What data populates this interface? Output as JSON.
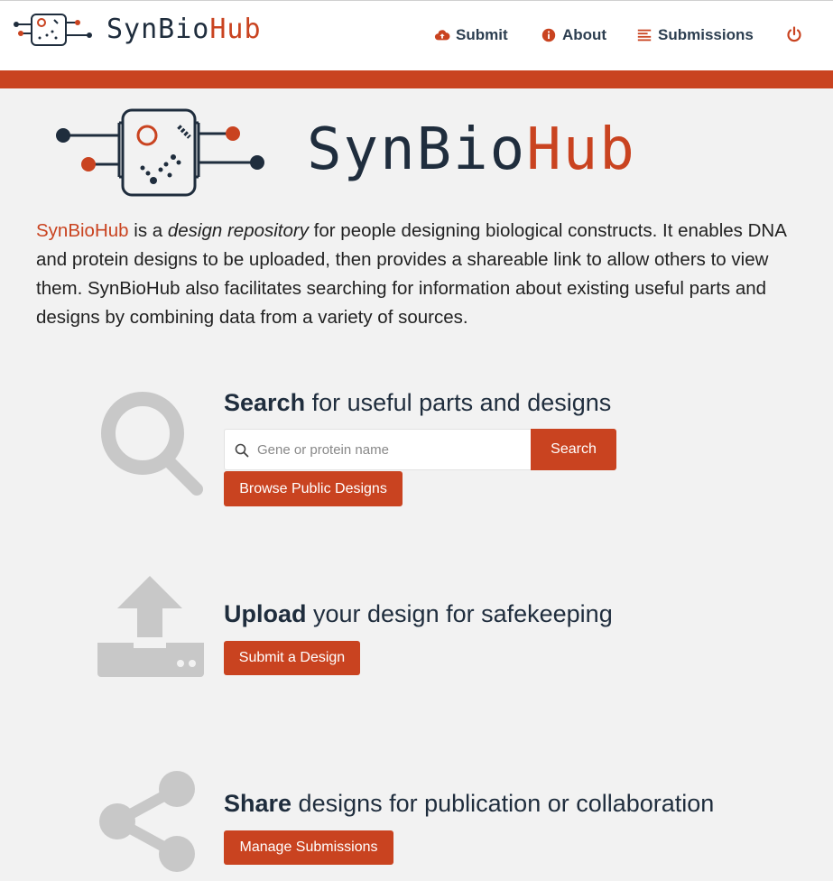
{
  "brand": {
    "part1": "SynBio",
    "part2": "Hub"
  },
  "nav": {
    "submit": "Submit",
    "about": "About",
    "submissions": "Submissions",
    "icons": {
      "submit": "cloud-upload-icon",
      "about": "info-icon",
      "submissions": "list-icon",
      "logout": "power-icon"
    }
  },
  "intro": {
    "brand": "SynBioHub",
    "text_before": " is a ",
    "emphasis": "design repository",
    "text_after": " for people designing biological constructs. It enables DNA and protein designs to be uploaded, then provides a shareable link to allow others to view them. SynBioHub also facilitates searching for information about existing useful parts and designs by combining data from a variety of sources."
  },
  "search_section": {
    "heading_bold": "Search",
    "heading_rest": " for useful parts and designs",
    "placeholder": "Gene or protein name",
    "button": "Search",
    "browse_button": "Browse Public Designs"
  },
  "upload_section": {
    "heading_bold": "Upload",
    "heading_rest": " your design for safekeeping",
    "button": "Submit a Design"
  },
  "share_section": {
    "heading_bold": "Share",
    "heading_rest": " designs for publication or collaboration",
    "button": "Manage Submissions"
  },
  "colors": {
    "accent": "#c94320",
    "dark": "#1f2d3d",
    "icon_gray": "#c8c8c8",
    "background": "#f2f2f2"
  }
}
